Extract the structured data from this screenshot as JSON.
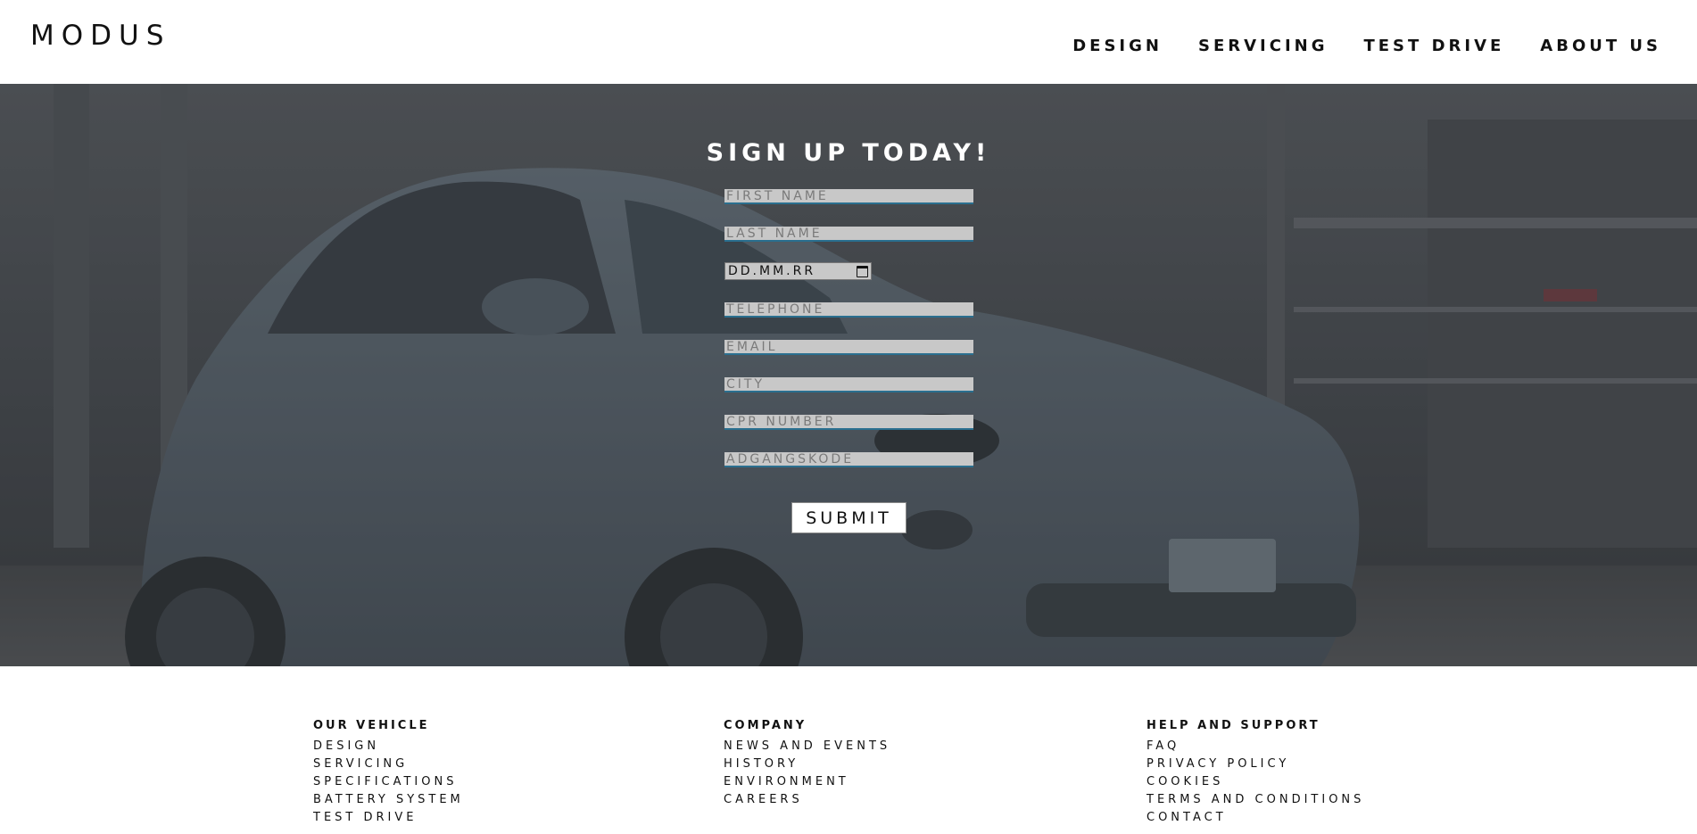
{
  "header": {
    "logo": "MODUS",
    "nav": [
      "DESIGN",
      "SERVICING",
      "TEST DRIVE",
      "ABOUT US"
    ]
  },
  "hero": {
    "title": "SIGN UP TODAY!",
    "fields": {
      "first_name": "FIRST NAME",
      "last_name": "LAST NAME",
      "date": "DD.MM.RR",
      "telephone": "TELEPHONE",
      "email": "EMAIL",
      "city": "CITY",
      "cpr": "CPR NUMBER",
      "password": "ADGANGSKODE"
    },
    "submit": "SUBMIT"
  },
  "footer": {
    "columns": [
      {
        "heading": "OUR VEHICLE",
        "links": [
          "DESIGN",
          "SERVICING",
          "SPECIFICATIONS",
          "BATTERY SYSTEM",
          "TEST DRIVE"
        ]
      },
      {
        "heading": "COMPANY",
        "links": [
          "NEWS AND EVENTS",
          "HISTORY",
          "ENVIRONMENT",
          "CAREERS"
        ]
      },
      {
        "heading": "HELP AND SUPPORT",
        "links": [
          "FAQ",
          "PRIVACY POLICY",
          "COOKIES",
          "TERMS AND CONDITIONS",
          "CONTACT"
        ]
      }
    ]
  },
  "colors": {
    "field_bg": "#c8c8c8",
    "field_underline": "#2a6f8f",
    "hero_tint": "#4a4e52"
  },
  "icons": {
    "calendar": "calendar-icon"
  }
}
